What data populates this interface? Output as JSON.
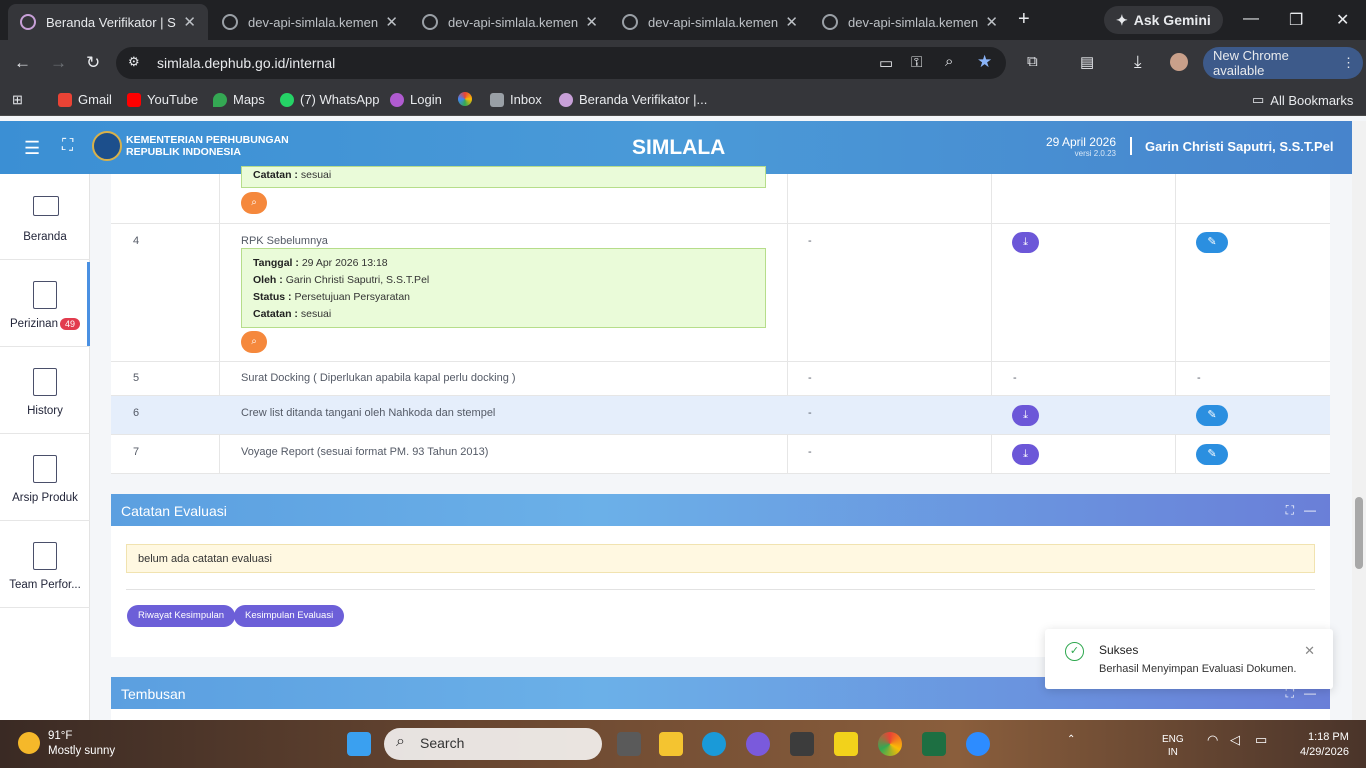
{
  "browser": {
    "tabs": [
      {
        "title": "Beranda Verifikator | Sim",
        "active": true
      },
      {
        "title": "dev-api-simlala.kemenhu",
        "active": false
      },
      {
        "title": "dev-api-simlala.kemenhu",
        "active": false
      },
      {
        "title": "dev-api-simlala.kemenhu",
        "active": false
      },
      {
        "title": "dev-api-simlala.kemenhu",
        "active": false
      }
    ],
    "ask_gemini": "Ask Gemini",
    "url": "simlala.dephub.go.id/internal",
    "new_chrome": "New Chrome available",
    "bookmarks": [
      "Gmail",
      "YouTube",
      "Maps",
      "(7) WhatsApp",
      "Login",
      "Inbox",
      "Beranda Verifikator |..."
    ],
    "all_bookmarks": "All Bookmarks"
  },
  "header": {
    "ministry_line1": "KEMENTERIAN PERHUBUNGAN",
    "ministry_line2": "REPUBLIK INDONESIA",
    "app_title": "SIMLALA",
    "date": "29 April 2026",
    "version": "versi 2.0.23",
    "user": "Garin Christi Saputri, S.S.T.Pel"
  },
  "sidebar": {
    "items": [
      {
        "label": "Beranda"
      },
      {
        "label": "Perizinan",
        "badge": "49"
      },
      {
        "label": "History"
      },
      {
        "label": "Arsip Produk"
      },
      {
        "label": "Team Perfor..."
      }
    ]
  },
  "documents": {
    "row3_catatan_label": "Catatan :",
    "row3_catatan_value": "sesuai",
    "rows": [
      {
        "no": "4",
        "name": "RPK Sebelumnya",
        "col3": "-",
        "detail": {
          "tanggal_label": "Tanggal :",
          "tanggal": "29 Apr 2026 13:18",
          "oleh_label": "Oleh :",
          "oleh": "Garin Christi Saputri, S.S.T.Pel",
          "status_label": "Status :",
          "status": "Persetujuan Persyaratan",
          "catatan_label": "Catatan :",
          "catatan": "sesuai"
        }
      },
      {
        "no": "5",
        "name": "Surat Docking ( Diperlukan apabila kapal perlu docking )",
        "col3": "-",
        "col4": "-",
        "col5": "-"
      },
      {
        "no": "6",
        "name": "Crew list ditanda tangani oleh Nahkoda dan stempel",
        "col3": "-"
      },
      {
        "no": "7",
        "name": "Voyage Report (sesuai format PM. 93 Tahun 2013)",
        "col3": "-"
      }
    ]
  },
  "catatan_evaluasi": {
    "title": "Catatan Evaluasi",
    "note": "belum ada catatan evaluasi",
    "btn_riwayat": "Riwayat Kesimpulan",
    "btn_kesimpulan": "Kesimpulan Evaluasi"
  },
  "tembusan": {
    "title": "Tembusan"
  },
  "toast": {
    "title": "Sukses",
    "message": "Berhasil Menyimpan Evaluasi Dokumen."
  },
  "taskbar": {
    "temp": "91°F",
    "weather": "Mostly sunny",
    "search": "Search",
    "lang1": "ENG",
    "lang2": "IN",
    "time": "1:18 PM",
    "date": "4/29/2026"
  },
  "colors": {
    "header": "#4a9ad8",
    "download_btn": "#6c57d8",
    "edit_btn": "#2b8fe0",
    "search_btn": "#f5883c"
  }
}
